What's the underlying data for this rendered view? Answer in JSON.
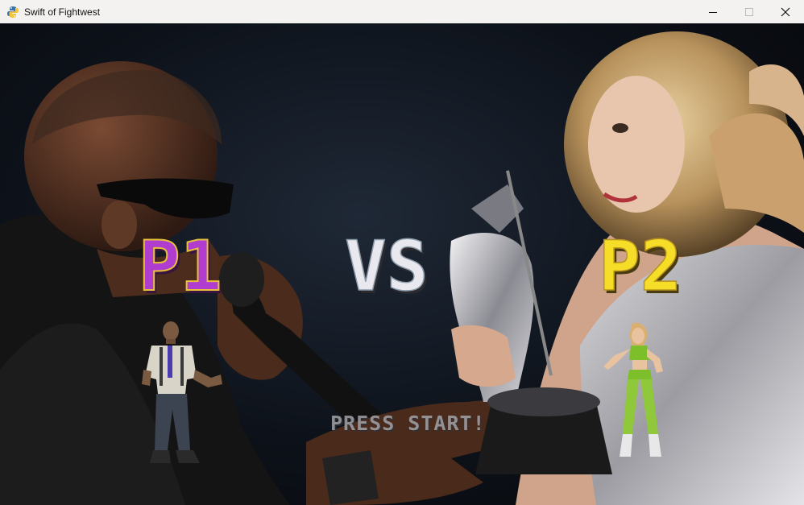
{
  "window": {
    "title": "Swift of Fightwest",
    "icon": "python-icon",
    "controls": [
      "minimize-icon",
      "maximize-icon",
      "close-icon"
    ]
  },
  "menu": {
    "p1_label": "P1",
    "vs_label": "VS",
    "p2_label": "P2",
    "press_start": "PRESS START!"
  },
  "colors": {
    "p1": "#b13dd0",
    "p2": "#f5dd28",
    "vs": "#e8e8ee",
    "press_start": "#a9a9ad"
  }
}
